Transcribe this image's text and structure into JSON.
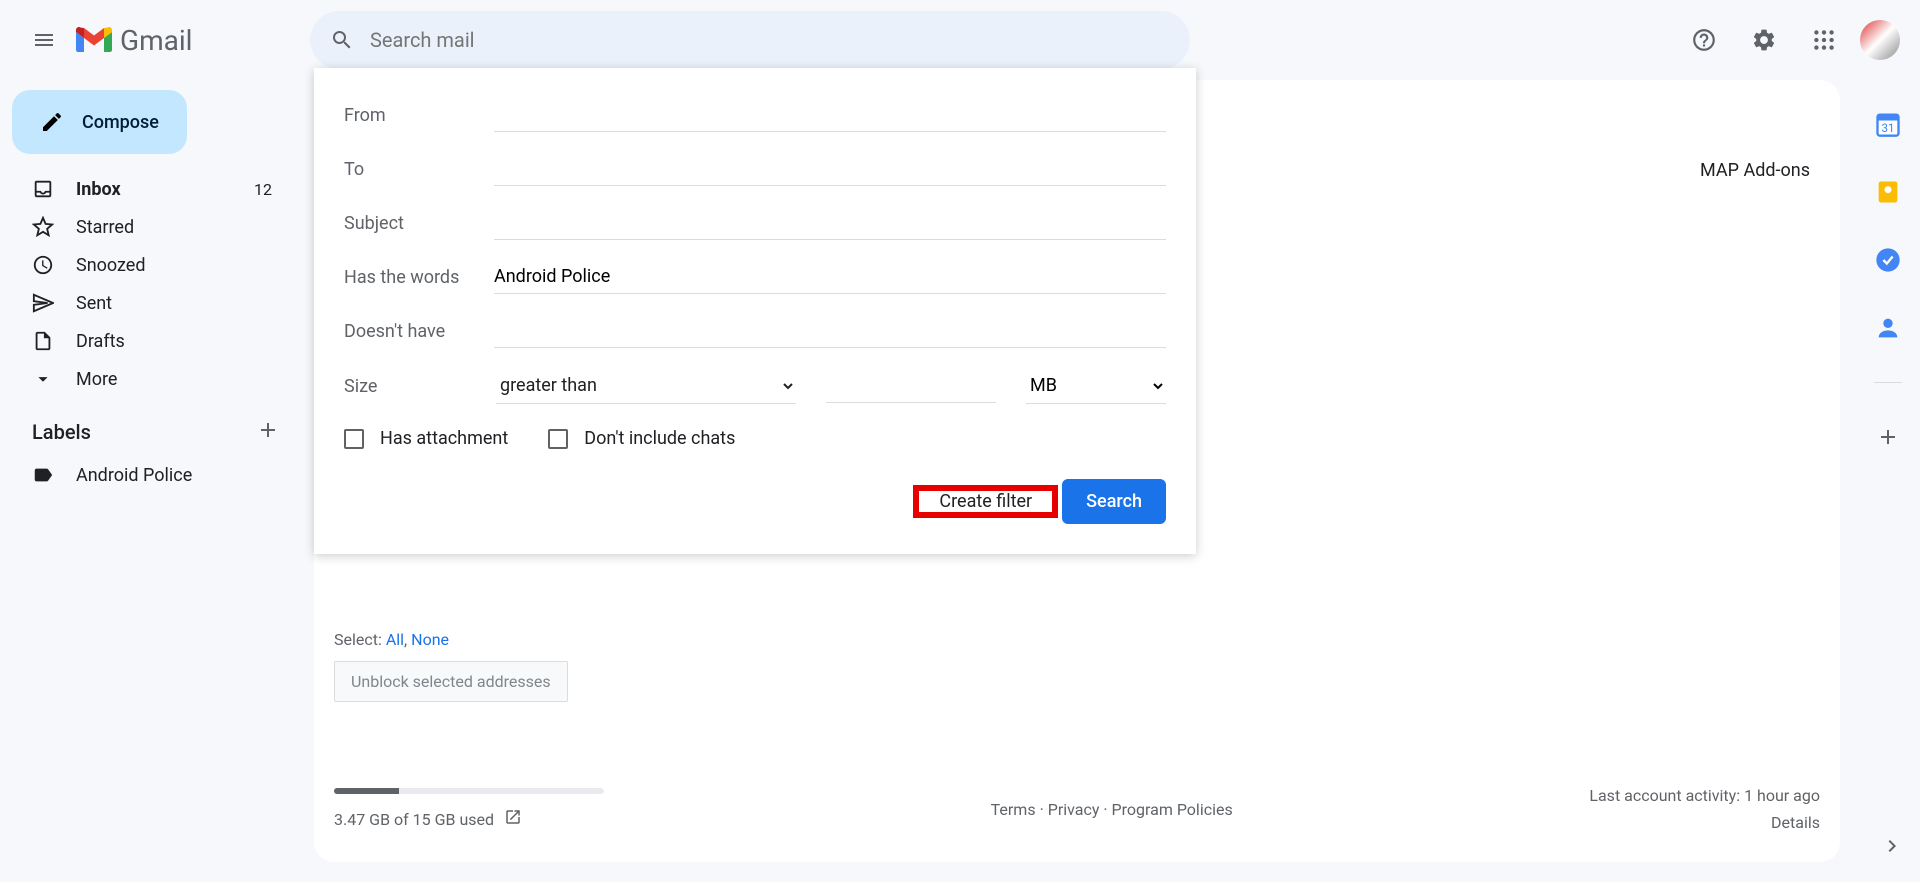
{
  "header": {
    "app_name": "Gmail",
    "search_placeholder": "Search mail"
  },
  "compose_label": "Compose",
  "nav": {
    "inbox": {
      "label": "Inbox",
      "count": "12"
    },
    "starred": {
      "label": "Starred"
    },
    "snoozed": {
      "label": "Snoozed"
    },
    "sent": {
      "label": "Sent"
    },
    "drafts": {
      "label": "Drafts"
    },
    "more": {
      "label": "More"
    }
  },
  "labels_header": "Labels",
  "labels": [
    {
      "name": "Android Police"
    }
  ],
  "peek_tabs": "MAP    Add-ons",
  "filter": {
    "from_label": "From",
    "to_label": "To",
    "subject_label": "Subject",
    "has_words_label": "Has the words",
    "has_words_value": "Android Police",
    "doesnt_have_label": "Doesn't have",
    "size_label": "Size",
    "size_op": "greater than",
    "size_unit": "MB",
    "has_attachment": "Has attachment",
    "no_chats": "Don't include chats",
    "create_filter": "Create filter",
    "search": "Search"
  },
  "blocked": {
    "select_prefix": "Select: ",
    "all": "All",
    "none": "None",
    "unblock": "Unblock selected addresses"
  },
  "footer": {
    "storage_text": "3.47 GB of 15 GB used",
    "storage_pct": 23,
    "terms": "Terms",
    "privacy": "Privacy",
    "policies": "Program Policies",
    "activity": "Last account activity: 1 hour ago",
    "details": "Details"
  }
}
